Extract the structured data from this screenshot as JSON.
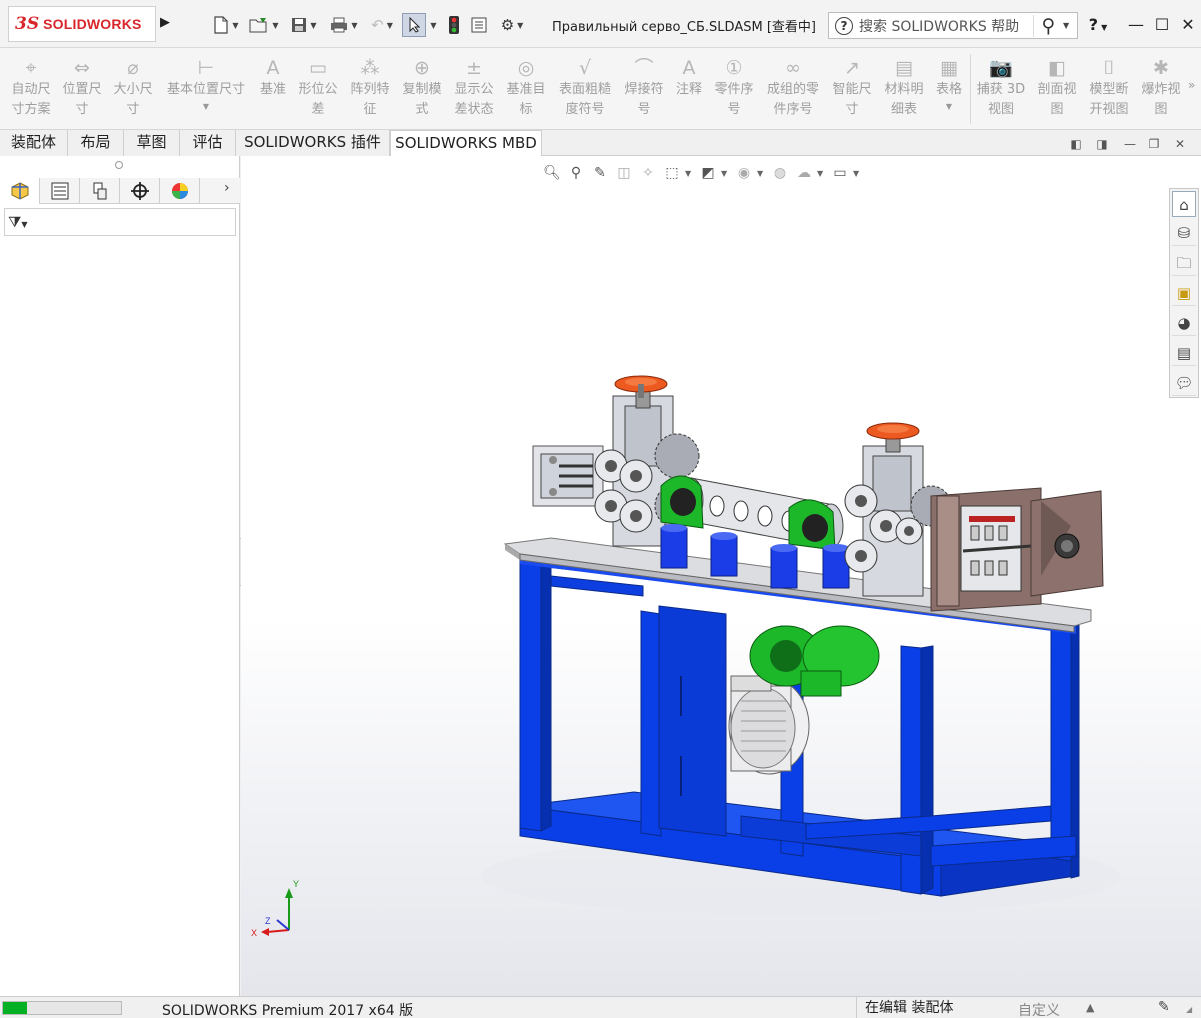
{
  "app": {
    "logo_ds": "3S",
    "logo_text": "SOLIDWORKS",
    "document_title": "Правильный серво_СБ.SLDASM [查看中]",
    "help_search_placeholder": "搜索 SOLIDWORKS 帮助",
    "help_button": "?"
  },
  "quick_access": {
    "icons": [
      "new-document-icon",
      "open-icon",
      "save-icon",
      "print-icon",
      "undo-icon",
      "select-arrow-icon",
      "traffic-light-icon",
      "file-properties-icon",
      "options-gear-icon"
    ]
  },
  "ribbon": {
    "items": [
      {
        "label": "自动尺\n寸方案",
        "icon": "auto-dimension-icon",
        "glyph": "⌖"
      },
      {
        "label": "位置尺\n寸",
        "icon": "location-dimension-icon",
        "glyph": "⇔"
      },
      {
        "label": "大小尺\n寸",
        "icon": "size-dimension-icon",
        "glyph": "⌀"
      },
      {
        "label": "基本位置尺寸",
        "icon": "basic-location-dimension-icon",
        "glyph": "⊢"
      },
      {
        "label": "基准",
        "icon": "datum-icon",
        "glyph": "A"
      },
      {
        "label": "形位公\n差",
        "icon": "geometric-tolerance-icon",
        "glyph": "▭"
      },
      {
        "label": "阵列特\n征",
        "icon": "pattern-feature-icon",
        "glyph": "⁂"
      },
      {
        "label": "复制模\n式",
        "icon": "copy-scheme-icon",
        "glyph": "⊕"
      },
      {
        "label": "显示公\n差状态",
        "icon": "tolerance-status-icon",
        "glyph": "±"
      },
      {
        "label": "基准目\n标",
        "icon": "datum-target-icon",
        "glyph": "◎"
      },
      {
        "label": "表面粗糙\n度符号",
        "icon": "surface-finish-icon",
        "glyph": "√"
      },
      {
        "label": "焊接符\n号",
        "icon": "weld-symbol-icon",
        "glyph": "⌒"
      },
      {
        "label": "注释",
        "icon": "note-icon",
        "glyph": "A"
      },
      {
        "label": "零件序\n号",
        "icon": "balloon-icon",
        "glyph": "①"
      },
      {
        "label": "成组的零\n件序号",
        "icon": "stacked-balloon-icon",
        "glyph": "∞"
      },
      {
        "label": "智能尺\n寸",
        "icon": "smart-dimension-icon",
        "glyph": "↗"
      },
      {
        "label": "材料明\n细表",
        "icon": "bom-icon",
        "glyph": "▤"
      },
      {
        "label": "表格",
        "icon": "table-icon",
        "glyph": "▦"
      },
      {
        "label": "捕获 3D\n视图",
        "icon": "capture-3d-view-icon",
        "glyph": "📷"
      },
      {
        "label": "剖面视\n图",
        "icon": "section-view-icon",
        "glyph": "◧"
      },
      {
        "label": "模型断\n开视图",
        "icon": "model-break-view-icon",
        "glyph": "⌷"
      },
      {
        "label": "爆炸视\n图",
        "icon": "exploded-view-icon",
        "glyph": "✱"
      }
    ]
  },
  "command_tabs": [
    {
      "label": "装配体",
      "active": false
    },
    {
      "label": "布局",
      "active": false
    },
    {
      "label": "草图",
      "active": false
    },
    {
      "label": "评估",
      "active": false
    },
    {
      "label": "SOLIDWORKS 插件",
      "active": false
    },
    {
      "label": "SOLIDWORKS MBD",
      "active": true
    }
  ],
  "left_panel": {
    "tabs": [
      "feature-manager-icon",
      "property-manager-icon",
      "configuration-manager-icon",
      "dimxpert-manager-icon",
      "display-manager-icon"
    ],
    "filter_icon": "filter-icon"
  },
  "heads_up_toolbar": [
    "zoom-to-fit-icon",
    "zoom-to-area-icon",
    "previous-view-icon",
    "section-view-icon",
    "dynamic-annotation-icon",
    "view-orientation-icon",
    "display-style-icon",
    "hide-show-items-icon",
    "edit-appearance-icon",
    "apply-scene-icon",
    "view-settings-icon"
  ],
  "task_pane": [
    "home-icon",
    "design-library-icon",
    "file-explorer-icon",
    "view-palette-icon",
    "appearances-icon",
    "custom-properties-icon",
    "forum-icon"
  ],
  "triad": {
    "x": "X",
    "y": "Y",
    "z": "Z"
  },
  "status_bar": {
    "progress": 0.2,
    "product": "SOLIDWORKS Premium 2017 x64 版",
    "mode": "在编辑 装配体",
    "units": "自定义",
    "units_dropdown": "▲"
  },
  "colors": {
    "frame_blue": "#0a3ee6",
    "plate_gray": "#dcdde0",
    "handwheel_orange": "#ec5a22",
    "bearing_green": "#1db82a",
    "motor_gray": "#e8e8ea",
    "gearbox_brown": "#8b6f6a"
  }
}
